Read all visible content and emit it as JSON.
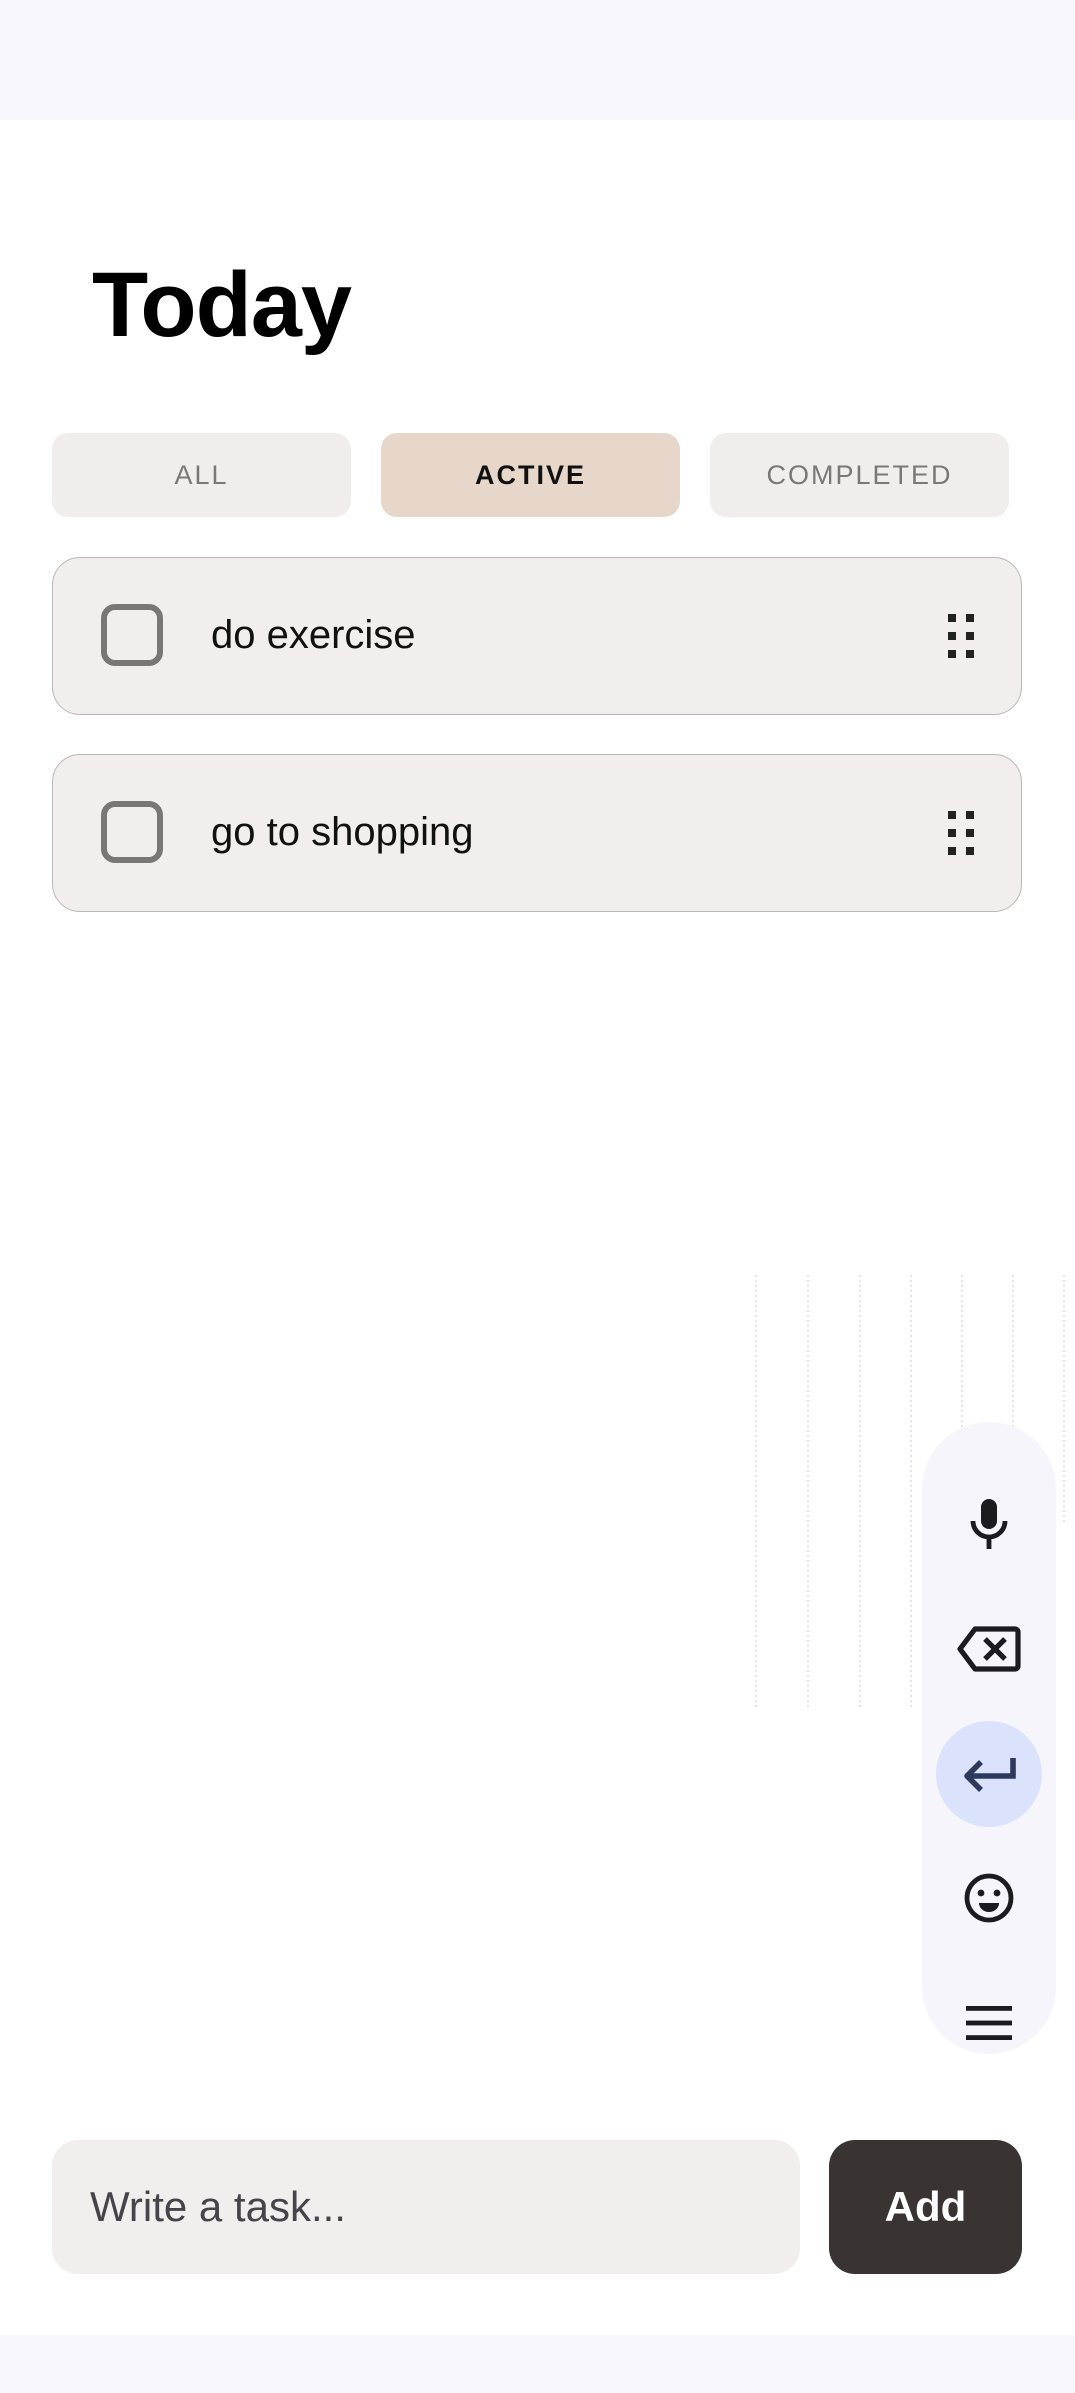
{
  "header": {
    "title": "Today"
  },
  "filters": {
    "tabs": [
      {
        "label": "ALL",
        "selected": false
      },
      {
        "label": "ACTIVE",
        "selected": true
      },
      {
        "label": "COMPLETED",
        "selected": false
      }
    ]
  },
  "tasks": [
    {
      "text": "do exercise",
      "checked": false
    },
    {
      "text": "go to shopping",
      "checked": false
    }
  ],
  "keyboard_toolbar": {
    "buttons": [
      "mic-icon",
      "backspace-icon",
      "enter-icon",
      "emoji-icon",
      "menu-icon"
    ],
    "highlighted": "enter-icon"
  },
  "composer": {
    "input_value": "",
    "placeholder": "Write a task...",
    "add_label": "Add"
  },
  "colors": {
    "selected_tab": "#e6d7ca",
    "card_background": "#f1eeed",
    "add_button": "#393332",
    "enter_highlight": "#dbe2fb"
  }
}
